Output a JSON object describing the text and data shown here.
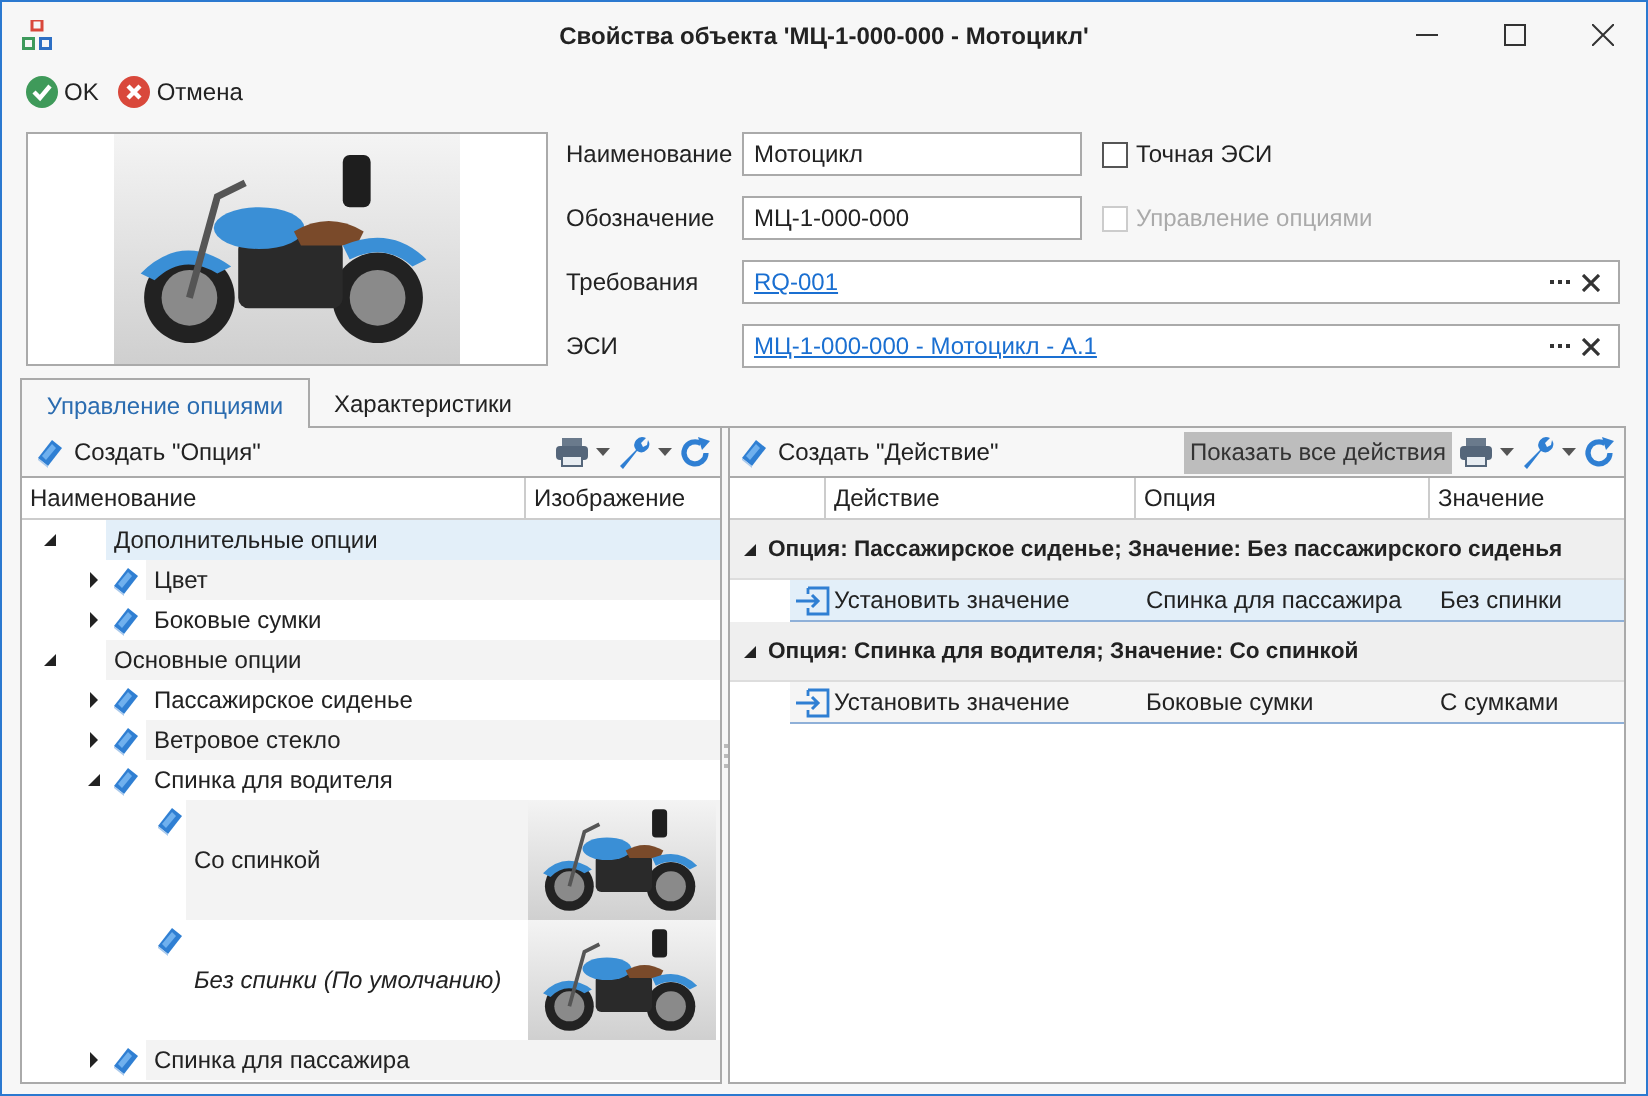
{
  "window": {
    "title": "Свойства объекта 'МЦ-1-000-000 - Мотоцикл'"
  },
  "toolbar": [
    {
      "kind": "ok",
      "label": "OK"
    },
    {
      "kind": "cancel",
      "label": "Отмена"
    }
  ],
  "fields": [
    {
      "kind": "text",
      "label": "Наименование",
      "value": "Мотоцикл"
    },
    {
      "kind": "text",
      "label": "Обозначение",
      "value": "МЦ-1-000-000"
    },
    {
      "kind": "link",
      "label": "Требования",
      "value": "RQ-001"
    },
    {
      "kind": "link",
      "label": "ЭСИ",
      "value": "МЦ-1-000-000 - Мотоцикл - А.1"
    }
  ],
  "checkboxes": [
    {
      "label": "Точная ЭСИ",
      "checked": false,
      "disabled": false
    },
    {
      "label": "Управление опциями",
      "checked": false,
      "disabled": true
    }
  ],
  "tabs": [
    {
      "label": "Управление опциями",
      "selected": true
    },
    {
      "label": "Характеристики",
      "selected": false
    }
  ],
  "options_panel": {
    "create_button": "Создать \"Опция\"",
    "columns": [
      "Наименование",
      "Изображение"
    ],
    "tree": [
      {
        "kind": "group",
        "label": "Дополнительные опции",
        "expanded": true,
        "selected": true,
        "children": [
          {
            "kind": "option",
            "label": "Цвет",
            "expanded": false,
            "selected": false
          },
          {
            "kind": "option",
            "label": "Боковые сумки",
            "expanded": false,
            "selected": false
          }
        ]
      },
      {
        "kind": "group",
        "label": "Основные опции",
        "expanded": true,
        "selected": false,
        "children": [
          {
            "kind": "option",
            "label": "Пассажирское сиденье",
            "expanded": false,
            "selected": false
          },
          {
            "kind": "option",
            "label": "Ветровое стекло",
            "expanded": false,
            "selected": false
          },
          {
            "kind": "option",
            "label": "Спинка для водителя",
            "expanded": true,
            "selected": false,
            "children": [
              {
                "kind": "value",
                "label": "Со спинкой",
                "default": false,
                "selected": false
              },
              {
                "kind": "value",
                "label": "Без спинки (По умолчанию)",
                "default": true,
                "selected": false
              }
            ]
          },
          {
            "kind": "option",
            "label": "Спинка для пассажира",
            "expanded": false,
            "selected": false
          }
        ]
      }
    ]
  },
  "actions_panel": {
    "create_button": "Создать \"Действие\"",
    "show_all": {
      "label": "Показать все действия",
      "pressed": true
    },
    "columns": [
      "Действие",
      "Опция",
      "Значение"
    ],
    "groups": [
      {
        "title": "Опция: Пассажирское сиденье; Значение: Без пассажирского сиденья",
        "expanded": true,
        "rows": [
          {
            "action": "Установить значение",
            "option": "Спинка для пассажира",
            "value": "Без спинки",
            "selected": true
          }
        ]
      },
      {
        "title": "Опция: Спинка для водителя; Значение: Со спинкой",
        "expanded": true,
        "rows": [
          {
            "action": "Установить значение",
            "option": "Боковые сумки",
            "value": "С сумками",
            "selected": false
          }
        ]
      }
    ]
  }
}
